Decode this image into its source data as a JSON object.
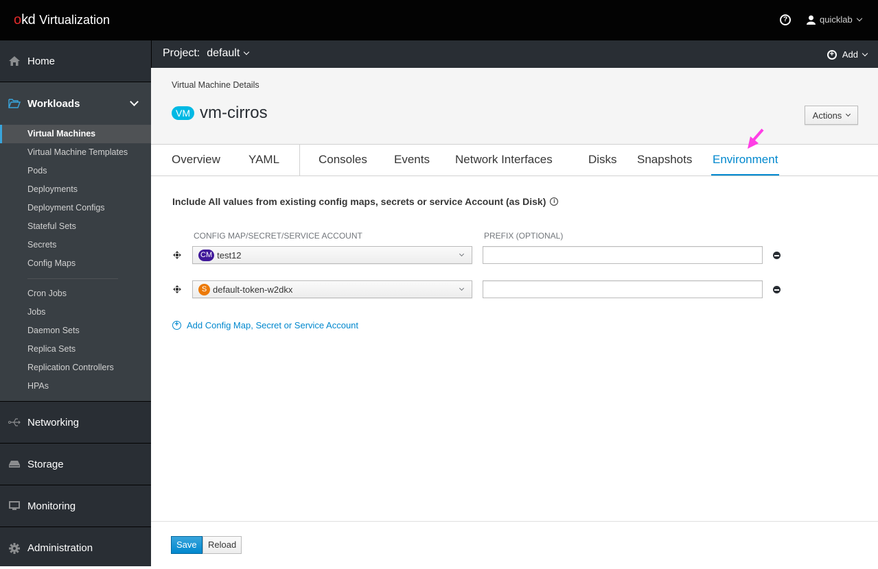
{
  "masthead": {
    "brand_o": "o",
    "brand_kd": "kd",
    "product": "Virtualization",
    "help_icon": "?",
    "user": "quicklab"
  },
  "sidebar": {
    "home": "Home",
    "workloads": {
      "label": "Workloads",
      "items": [
        {
          "label": "Virtual Machines",
          "active": true
        },
        {
          "label": "Virtual Machine Templates"
        },
        {
          "label": "Pods"
        },
        {
          "label": "Deployments"
        },
        {
          "label": "Deployment Configs"
        },
        {
          "label": "Stateful Sets"
        },
        {
          "label": "Secrets"
        },
        {
          "label": "Config Maps"
        }
      ],
      "items2": [
        {
          "label": "Cron Jobs"
        },
        {
          "label": "Jobs"
        },
        {
          "label": "Daemon Sets"
        },
        {
          "label": "Replica Sets"
        },
        {
          "label": "Replication Controllers"
        },
        {
          "label": "HPAs"
        }
      ]
    },
    "networking": "Networking",
    "storage": "Storage",
    "monitoring": "Monitoring",
    "administration": "Administration"
  },
  "projectbar": {
    "label": "Project:",
    "value": "default",
    "add": "Add"
  },
  "header": {
    "breadcrumb": "Virtual Machine Details",
    "badge": "VM",
    "title": "vm-cirros",
    "actions": "Actions"
  },
  "tabs": [
    {
      "label": "Overview"
    },
    {
      "label": "YAML"
    },
    {
      "label": "Consoles"
    },
    {
      "label": "Events"
    },
    {
      "label": "Network Interfaces"
    },
    {
      "label": "Disks"
    },
    {
      "label": "Snapshots"
    },
    {
      "label": "Environment",
      "active": true
    }
  ],
  "environment": {
    "intro": "Include All values from existing config maps, secrets or service Account (as Disk)",
    "col_source": "CONFIG MAP/SECRET/SERVICE ACCOUNT",
    "col_prefix": "PREFIX (OPTIONAL)",
    "rows": [
      {
        "badge": "CM",
        "badge_color": "#40199a",
        "value": "test12",
        "prefix": ""
      },
      {
        "badge": "S",
        "badge_color": "#ec7a08",
        "value": "default-token-w2dkx",
        "prefix": ""
      }
    ],
    "add_link": "Add Config Map, Secret or Service Account"
  },
  "footer": {
    "save": "Save",
    "reload": "Reload"
  },
  "colors": {
    "accent": "#0088ce",
    "annotation_arrow": "#ff3ee6"
  }
}
